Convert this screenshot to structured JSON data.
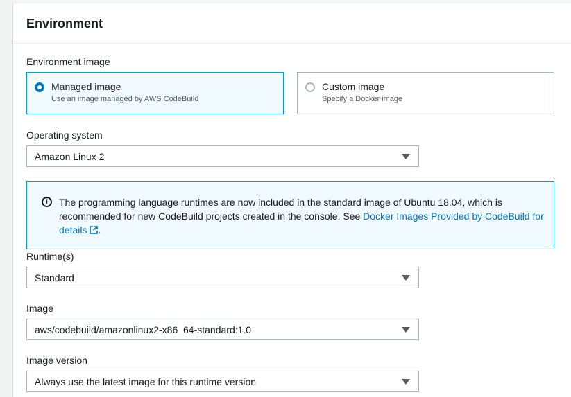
{
  "panel": {
    "title": "Environment"
  },
  "environment_image": {
    "label": "Environment image",
    "options": [
      {
        "title": "Managed image",
        "description": "Use an image managed by AWS CodeBuild",
        "selected": true
      },
      {
        "title": "Custom image",
        "description": "Specify a Docker image",
        "selected": false
      }
    ]
  },
  "operating_system": {
    "label": "Operating system",
    "value": "Amazon Linux 2"
  },
  "info_alert": {
    "text": "The programming language runtimes are now included in the standard image of Ubuntu 18.04, which is recommended for new CodeBuild projects created in the console. See ",
    "link_text": "Docker Images Provided by CodeBuild for details",
    "suffix": ".",
    "icon": "info-icon"
  },
  "runtime": {
    "label": "Runtime(s)",
    "value": "Standard"
  },
  "image": {
    "label": "Image",
    "value": "aws/codebuild/amazonlinux2-x86_64-standard:1.0"
  },
  "image_version": {
    "label": "Image version",
    "value": "Always use the latest image for this runtime version"
  },
  "colors": {
    "accent": "#0073bb",
    "selected_border": "#00a1c9",
    "selected_bg": "#f1faff"
  }
}
